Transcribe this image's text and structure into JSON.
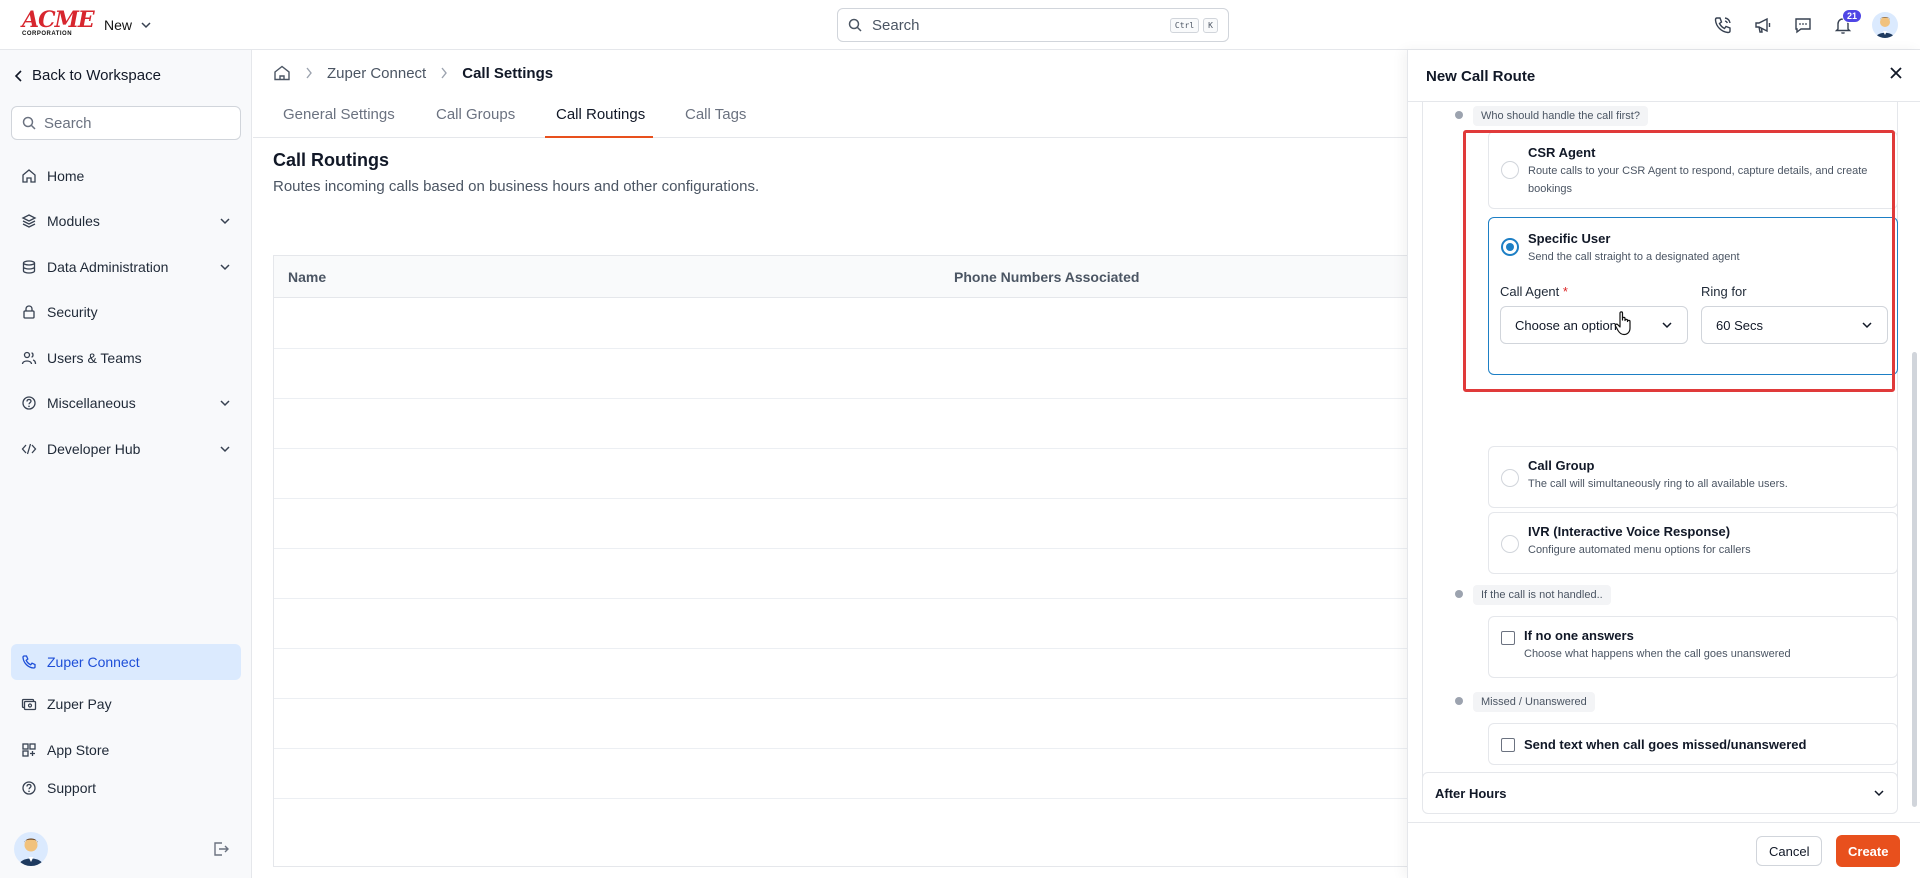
{
  "app": {
    "logo_text": "ACME",
    "logo_sub": "CORPORATION",
    "new_label": "New",
    "search_placeholder": "Search",
    "search_kbd_1": "Ctrl",
    "search_kbd_2": "K",
    "notification_count": "21"
  },
  "sidebar": {
    "back_label": "Back to Workspace",
    "search_placeholder": "Search",
    "items": [
      {
        "label": "Home",
        "icon": "home-icon"
      },
      {
        "label": "Modules",
        "icon": "layers-icon",
        "expandable": true
      },
      {
        "label": "Data Administration",
        "icon": "database-icon",
        "expandable": true
      },
      {
        "label": "Security",
        "icon": "lock-icon"
      },
      {
        "label": "Users & Teams",
        "icon": "users-icon"
      },
      {
        "label": "Miscellaneous",
        "icon": "help-circle-icon",
        "expandable": true
      },
      {
        "label": "Developer Hub",
        "icon": "code-icon",
        "expandable": true
      }
    ],
    "bottom_items": [
      {
        "label": "Zuper Connect",
        "icon": "phone-icon",
        "active": true
      },
      {
        "label": "Zuper Pay",
        "icon": "pay-icon"
      },
      {
        "label": "App Store",
        "icon": "grid-icon"
      },
      {
        "label": "Support",
        "icon": "help-circle-icon"
      }
    ]
  },
  "main": {
    "breadcrumb": [
      "Zuper Connect",
      "Call Settings"
    ],
    "tabs": [
      {
        "label": "General Settings",
        "active": false
      },
      {
        "label": "Call Groups",
        "active": false
      },
      {
        "label": "Call Routings",
        "active": true
      },
      {
        "label": "Call Tags",
        "active": false
      }
    ],
    "title": "Call Routings",
    "subtitle": "Routes incoming calls based on business hours and other configurations.",
    "table_headers": [
      "Name",
      "Phone Numbers Associated"
    ]
  },
  "panel": {
    "title": "New Call Route",
    "step1_label": "Who should handle the call first?",
    "options": [
      {
        "title": "CSR Agent",
        "desc": "Route calls to your CSR Agent to respond, capture details, and create bookings",
        "selected": false
      },
      {
        "title": "Specific User",
        "desc": "Send the call straight to a designated agent",
        "selected": true
      },
      {
        "title": "Call Group",
        "desc": "The call will simultaneously ring to all available users.",
        "selected": false
      },
      {
        "title": "IVR (Interactive Voice Response)",
        "desc": "Configure automated menu options for callers",
        "selected": false
      }
    ],
    "call_agent_label": "Call Agent",
    "call_agent_required": "*",
    "call_agent_value": "Choose an option",
    "ring_for_label": "Ring for",
    "ring_for_value": "60 Secs",
    "step2_label": "If the call is not handled..",
    "no_answer_title": "If no one answers",
    "no_answer_desc": "Choose what happens when the call goes unanswered",
    "step3_label": "Missed / Unanswered",
    "send_text_label": "Send text when call goes missed/unanswered",
    "after_hours_label": "After Hours",
    "cancel_label": "Cancel",
    "create_label": "Create"
  },
  "colors": {
    "accent": "#e8501d",
    "selected_blue": "#1d7fc5",
    "highlight_red": "#e03a3a",
    "active_nav_bg": "#dbeafe"
  }
}
